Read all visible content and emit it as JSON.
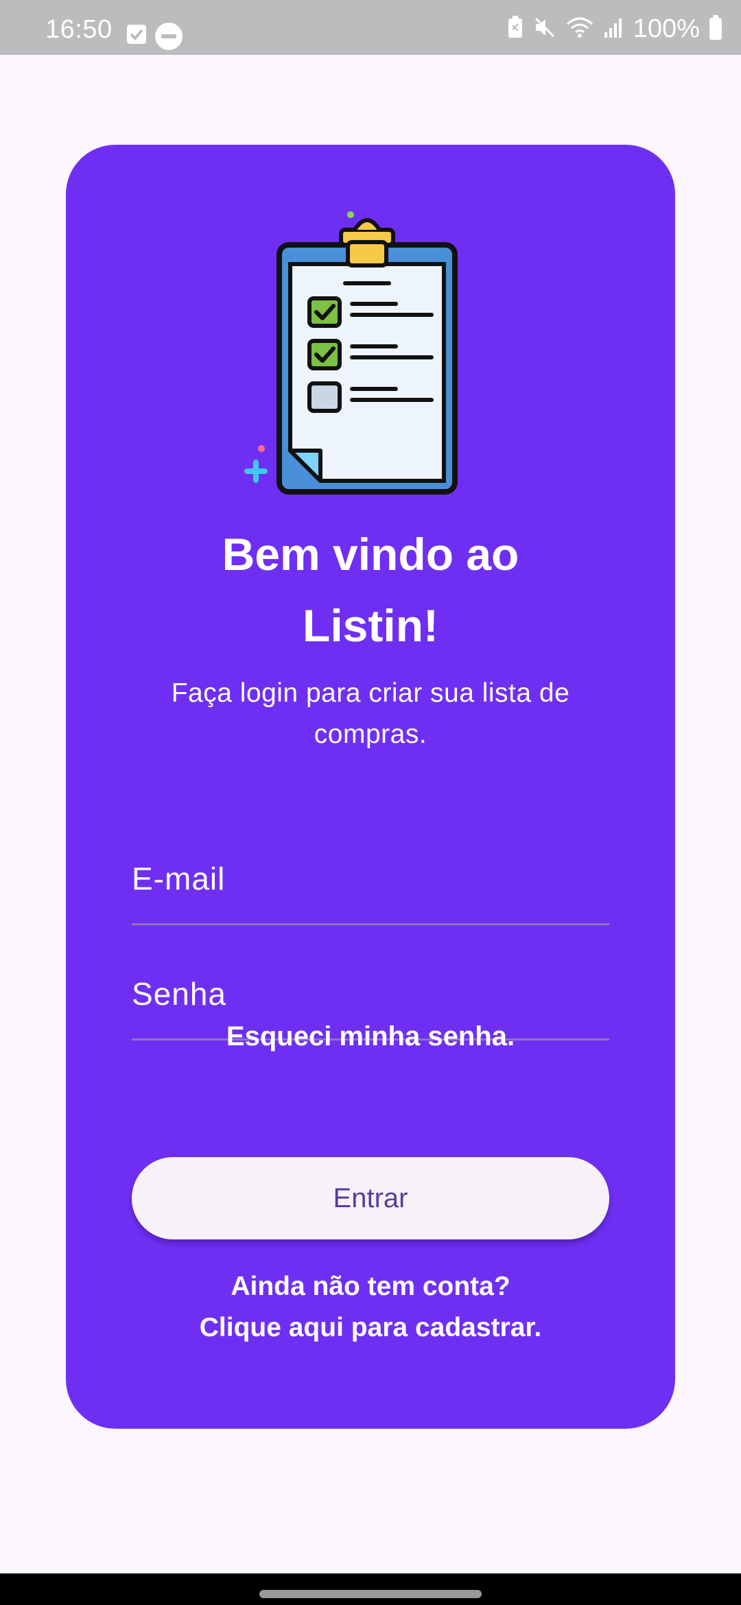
{
  "status_bar": {
    "time": "16:50",
    "battery_text": "100%",
    "icons": [
      "check-square-icon",
      "do-not-disturb-icon",
      "battery-saver-icon",
      "mute-icon",
      "wifi-icon",
      "signal-icon",
      "battery-icon"
    ]
  },
  "login": {
    "title_line1": "Bem vindo ao",
    "title_line2": "Listin!",
    "subtitle": "Faça login para criar sua lista de compras.",
    "email_placeholder": "E-mail",
    "password_placeholder": "Senha",
    "forgot_password": "Esqueci minha senha.",
    "enter_button": "Entrar",
    "register_line1": "Ainda não tem conta?",
    "register_line2": "Clique aqui para cadastrar.",
    "illustration": "clipboard-checklist-icon"
  },
  "colors": {
    "card": "#6f2ff3",
    "background": "#fcf7fe",
    "status_bar": "#bdbbbe",
    "button_bg": "#f6f2f8",
    "button_text": "#5a3c98"
  }
}
